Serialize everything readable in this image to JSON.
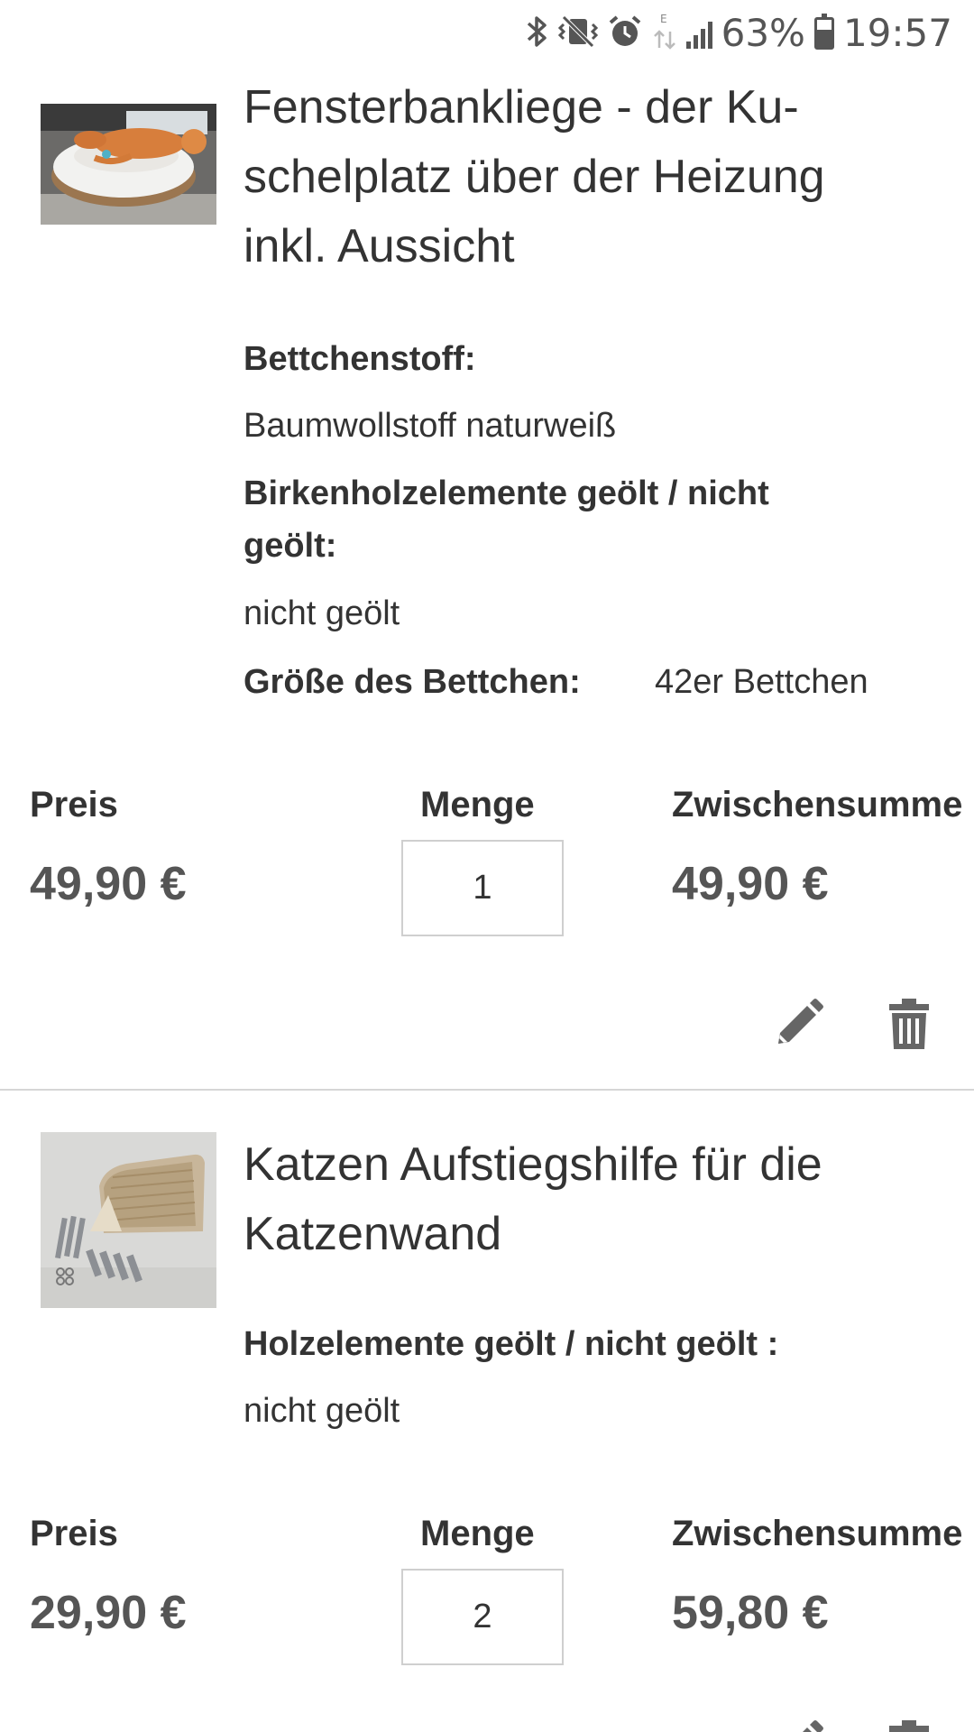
{
  "status_bar": {
    "battery_percent": "63%",
    "time": "19:57",
    "network": "E",
    "battery_level": 0.63,
    "icons": [
      "bluetooth-icon",
      "vibrate-icon",
      "alarm-icon",
      "data-arrows-icon",
      "signal-icon",
      "battery-icon"
    ]
  },
  "items": [
    {
      "title": "Fensterbankliege - der Ku-schelplatz über der Heizung inkl. Aussicht",
      "title_lines": [
        "Fensterbankliege - der Ku-",
        "schelplatz über der Heizung",
        "inkl. Aussicht"
      ],
      "options": {
        "opt1_label": "Bettchenstoff:",
        "opt1_value": "Baumwollstoff naturweiß",
        "opt2_label_line1": "Birkenholzelemente geölt / nicht",
        "opt2_label_line2": "geölt:",
        "opt2_value": "nicht geölt",
        "opt3_label": "Größe des Bettchen:",
        "opt3_value": "42er Bettchen"
      },
      "price_label": "Preis",
      "price": "49,90 €",
      "qty_label": "Menge",
      "qty": "1",
      "subtotal_label": "Zwischensumme",
      "subtotal": "49,90 €"
    },
    {
      "title": "Katzen Aufstiegshilfe für die Katzenwand",
      "title_lines": [
        "Katzen Aufstiegshilfe für die",
        "Katzenwand"
      ],
      "options": {
        "opt1_label": "Holzelemente geölt / nicht geölt :",
        "opt1_value": "nicht geölt"
      },
      "price_label": "Preis",
      "price": "29,90 €",
      "qty_label": "Menge",
      "qty": "2",
      "subtotal_label": "Zwischensumme",
      "subtotal": "59,80 €"
    }
  ],
  "colors": {
    "text": "#333333",
    "price": "#555555",
    "divider": "#d6d6d6",
    "icon": "#666666"
  }
}
